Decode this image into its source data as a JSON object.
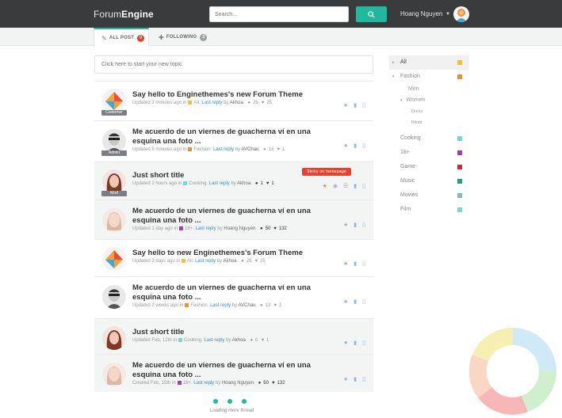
{
  "header": {
    "logo_prefix": "Forum",
    "logo_suffix": "Engine",
    "search_placeholder": "Search...",
    "user_name": "Hoang Nguyen"
  },
  "tabs": [
    {
      "label": "ALL POST",
      "count": "9",
      "icon": "edit-icon"
    },
    {
      "label": "FOLLOWING",
      "count": "2",
      "icon": "plus-icon"
    }
  ],
  "new_topic_placeholder": "Click here to start your new topic",
  "colors": {
    "accent": "#1fb99e",
    "badge_red": "#e5412d",
    "link": "#2a8fc4"
  },
  "threads": [
    {
      "title": "Say hello to Enginethemes's new Forum Theme",
      "role": "Customer",
      "prefix": "Updated 3 minutes ago in",
      "category": "All",
      "cat_color": "#f1c232",
      "reply_label": "Last reply",
      "by": "by",
      "user": "Akhoa",
      "comments": "25",
      "likes": "25"
    },
    {
      "title": "Me acuerdo de un viernes de guacherna ví en una esquina una foto ...",
      "role": "Admin",
      "prefix": "Updated 5 minutes ago in",
      "category": "Fashion",
      "cat_color": "#e69138",
      "reply_label": "Last reply",
      "by": "by",
      "user": "AVChau",
      "comments": "13",
      "likes": "1"
    },
    {
      "title": "Just short title",
      "role": "Mod",
      "prefix": "Updated 2 hours ago in",
      "category": "Cooking",
      "cat_color": "#76d7d7",
      "reply_label": "Last reply",
      "by": "by",
      "user": "Akhoa",
      "comments": "1",
      "likes": "1",
      "tooltip": "Sticky on homepage"
    },
    {
      "title": "Me acuerdo de un viernes de guacherna ví en una esquina una foto ...",
      "role": "",
      "prefix": "Updated 1 day ago in",
      "category": "18+",
      "cat_color": "#9c3fb0",
      "reply_label": "Last reply",
      "by": "by",
      "user": "Hoang Nguyen",
      "comments": "50",
      "likes": "132"
    },
    {
      "title": "Say hello to new Enginethemes's Forum Theme",
      "role": "",
      "prefix": "Updated 3 days ago in",
      "category": "All",
      "cat_color": "#f1c232",
      "reply_label": "Last reply",
      "by": "by",
      "user": "Akhoa",
      "comments": "25",
      "likes": "25"
    },
    {
      "title": "Me acuerdo de un viernes de guacherna ví en una esquina una foto ...",
      "role": "",
      "prefix": "Updated 2 weeks ago in",
      "category": "Fashion",
      "cat_color": "#e69138",
      "reply_label": "Last reply",
      "by": "by",
      "user": "AVChau",
      "comments": "13",
      "likes": "1"
    },
    {
      "title": "Just short title",
      "role": "",
      "prefix": "Updated Feb, 12th in",
      "category": "Cooking",
      "cat_color": "#76d7d7",
      "reply_label": "Last reply",
      "by": "by",
      "user": "Akhoa",
      "comments": "0",
      "likes": "1"
    },
    {
      "title": "Me acuerdo de un viernes de guacherna ví en una esquina una foto ...",
      "role": "",
      "prefix": "Created Feb, 15th in",
      "category": "18+",
      "cat_color": "#9c3fb0",
      "reply_label": "Last reply",
      "by": "by",
      "user": "Hoang Nguyen",
      "comments": "50",
      "likes": "132"
    }
  ],
  "loading_text": "Loading more thread",
  "categories": [
    {
      "label": "All",
      "color": "#f1c232",
      "active": true
    },
    {
      "label": "Fashion",
      "color": "#e69138",
      "expanded": true
    },
    {
      "label": "Men",
      "level": 1
    },
    {
      "label": "Women",
      "level": 1,
      "expanded": true
    },
    {
      "label": "Dress",
      "level": 2
    },
    {
      "label": "Bikini",
      "level": 2
    },
    {
      "label": "Cooking",
      "color": "#76d7d7"
    },
    {
      "label": "18+",
      "color": "#9c3fb0"
    },
    {
      "label": "Game",
      "color": "#cc2a36"
    },
    {
      "label": "Music",
      "color": "#1fa27a"
    },
    {
      "label": "Movies",
      "color": "#7fb8d1"
    },
    {
      "label": "Film",
      "color": "#76d7d7"
    }
  ]
}
